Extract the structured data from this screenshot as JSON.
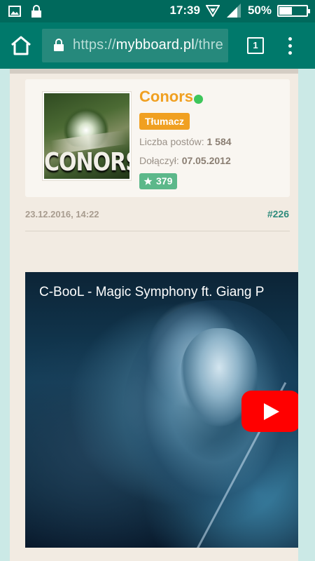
{
  "status_bar": {
    "time": "17:39",
    "battery_percent": "50%",
    "battery_level": 0.5,
    "icons": [
      "image-icon",
      "lock-icon",
      "vibrate-icon",
      "wifi-icon",
      "signal-icon",
      "battery-icon"
    ]
  },
  "browser": {
    "url_scheme": "https://",
    "url_host": "mybboard.pl",
    "url_rest": "/thre",
    "tab_count": "1",
    "icons": [
      "home-icon",
      "lock-icon",
      "tabs-icon",
      "overflow-menu-icon"
    ]
  },
  "post": {
    "avatar_text": "CONORS",
    "username": "Conors",
    "online": true,
    "rank": "Tłumacz",
    "posts_label": "Liczba postów:",
    "posts_value": "1 584",
    "joined_label": "Dołączył:",
    "joined_value": "07.05.2012",
    "reputation": "379",
    "date": "23.12.2016, 14:22",
    "number": "#226"
  },
  "video": {
    "title": "C-BooL - Magic Symphony ft. Giang P",
    "icons": [
      "youtube-play-icon"
    ]
  },
  "colors": {
    "status_bar": "#00695c",
    "toolbar": "#00796b",
    "username": "#f0a021",
    "online": "#3ec65b",
    "reputation": "#5cb88a",
    "post_number": "#2e8b7c"
  }
}
